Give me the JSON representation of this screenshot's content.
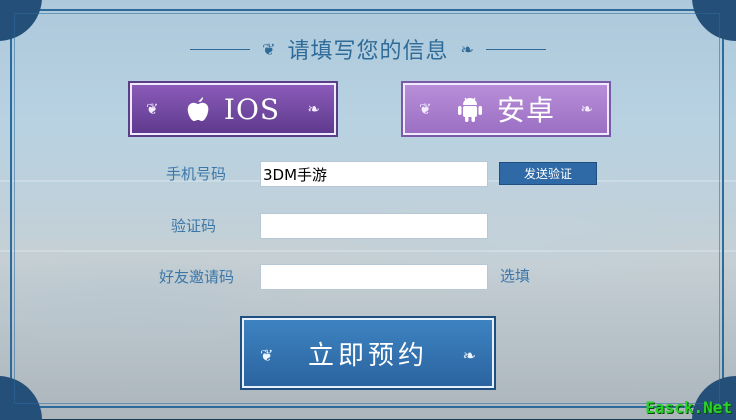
{
  "form": {
    "title": "请填写您的信息",
    "platforms": [
      {
        "label": "IOS",
        "icon": "apple-icon",
        "selected": true
      },
      {
        "label": "安卓",
        "icon": "android-icon",
        "selected": false
      }
    ],
    "phone": {
      "label": "手机号码",
      "value": "3DM手游"
    },
    "send_code_label": "发送验证",
    "code": {
      "label": "验证码",
      "value": ""
    },
    "invite": {
      "label": "好友邀请码",
      "value": "",
      "hint": "选填"
    },
    "submit_label": "立即预约"
  },
  "ornaments": {
    "left": "❦",
    "right": "❧"
  },
  "watermark": "Easck.Net",
  "colors": {
    "accent": "#2f6b98",
    "ios_button": "#6b45a0",
    "android_button": "#a77ccc",
    "submit_button": "#336fac"
  }
}
